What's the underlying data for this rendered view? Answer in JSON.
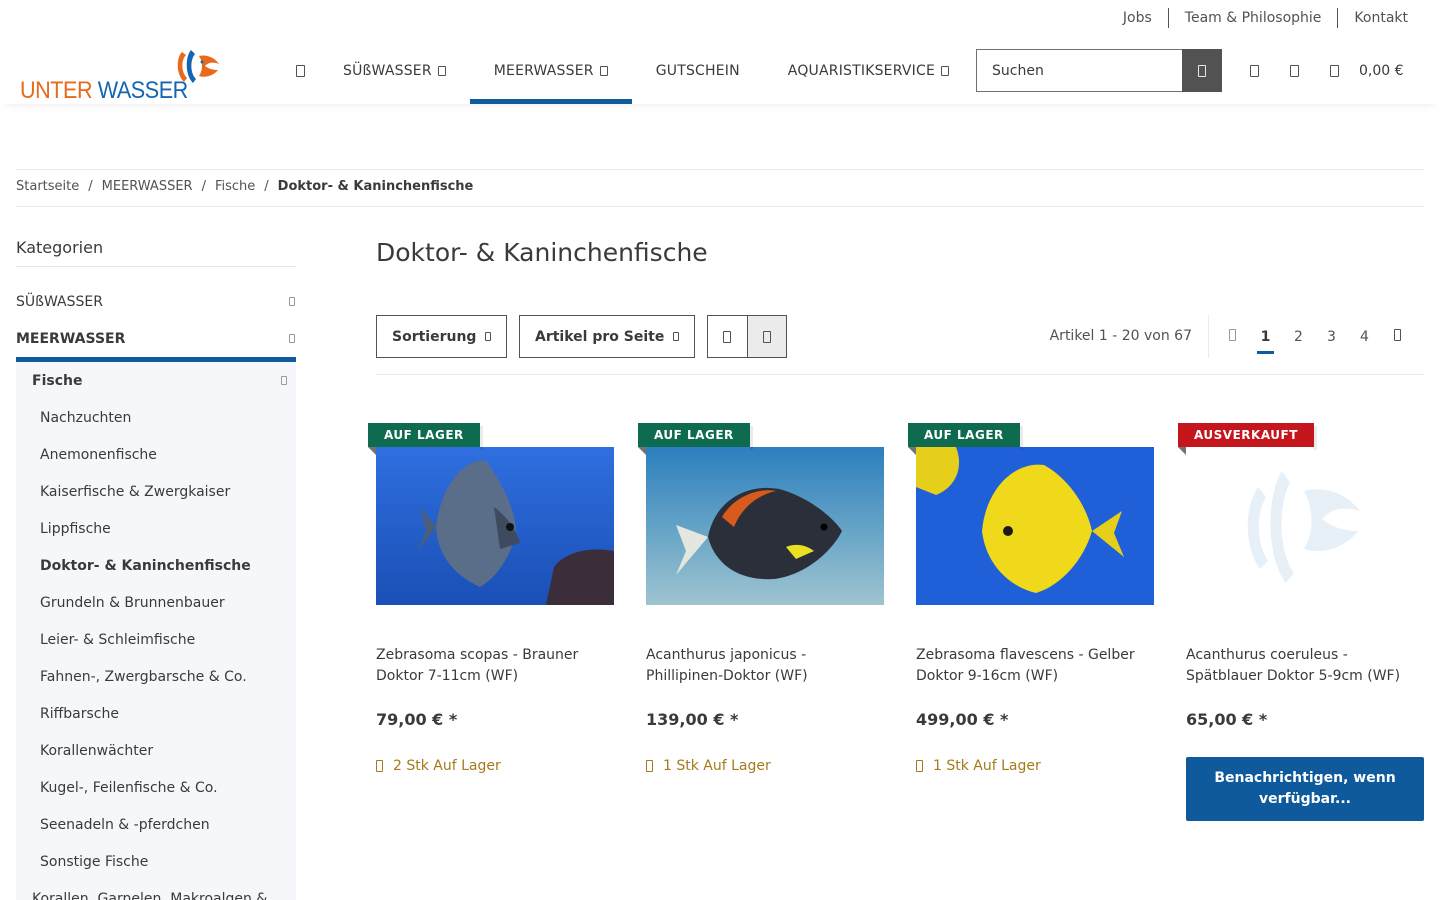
{
  "top_links": [
    "Jobs",
    "Team & Philosophie",
    "Kontakt"
  ],
  "logo": {
    "part1": "UNTER",
    "part2": "WASSER"
  },
  "nav": {
    "items": [
      {
        "label": "SÜßWASSER",
        "dropdown": true,
        "active": false
      },
      {
        "label": "MEERWASSER",
        "dropdown": true,
        "active": true
      },
      {
        "label": "GUTSCHEIN",
        "dropdown": false,
        "active": false
      },
      {
        "label": "AQUARISTIKSERVICE",
        "dropdown": true,
        "active": false
      }
    ]
  },
  "search": {
    "placeholder": "Suchen"
  },
  "cart": {
    "total": "0,00 €"
  },
  "breadcrumb": [
    "Startseite",
    "MEERWASSER",
    "Fische",
    "Doktor- & Kaninchenfische"
  ],
  "sidebar": {
    "title": "Kategorien",
    "top": [
      "SÜßWASSER",
      "MEERWASSER"
    ],
    "sub_title": "Fische",
    "children": [
      "Nachzuchten",
      "Anemonenfische",
      "Kaiserfische & Zwergkaiser",
      "Lippfische",
      "Doktor- & Kaninchenfische",
      "Grundeln & Brunnenbauer",
      "Leier- & Schleimfische",
      "Fahnen-, Zwergbarsche & Co.",
      "Riffbarsche",
      "Korallenwächter",
      "Kugel-, Feilenfische & Co.",
      "Seenadeln & -pferdchen",
      "Sonstige Fische"
    ],
    "next": "Korallen, Garnelen, Makroalgen &..."
  },
  "main": {
    "title": "Doktor- & Kaninchenfische",
    "sort_label": "Sortierung",
    "per_page_label": "Artikel pro Seite",
    "count_text": "Artikel 1 - 20 von 67",
    "pages": [
      "1",
      "2",
      "3",
      "4"
    ],
    "current_page": "1"
  },
  "products": [
    {
      "badge": "AUF LAGER",
      "badge_color": "#0f6b4f",
      "name": "Zebrasoma scopas - Brauner Doktor 7-11cm (WF)",
      "price": "79,00 € *",
      "stock": "2 Stk Auf Lager"
    },
    {
      "badge": "AUF LAGER",
      "badge_color": "#0f6b4f",
      "name": "Acanthurus japonicus - Phillipinen-Doktor (WF)",
      "price": "139,00 € *",
      "stock": "1 Stk Auf Lager"
    },
    {
      "badge": "AUF LAGER",
      "badge_color": "#0f6b4f",
      "name": "Zebrasoma flavescens - Gelber Doktor 9-16cm (WF)",
      "price": "499,00 € *",
      "stock": "1 Stk Auf Lager"
    },
    {
      "badge": "AUSVERKAUFT",
      "badge_color": "#c4161c",
      "name": "Acanthurus coeruleus - Spätblauer Doktor 5-9cm (WF)",
      "price": "65,00 € *",
      "notify_label": "Benachrichtigen, wenn verfügbar..."
    }
  ],
  "colors": {
    "accent": "#0e5a9c",
    "in_stock": "#0f6b4f",
    "sold_out": "#c4161c",
    "stock_text": "#a57a1a"
  }
}
